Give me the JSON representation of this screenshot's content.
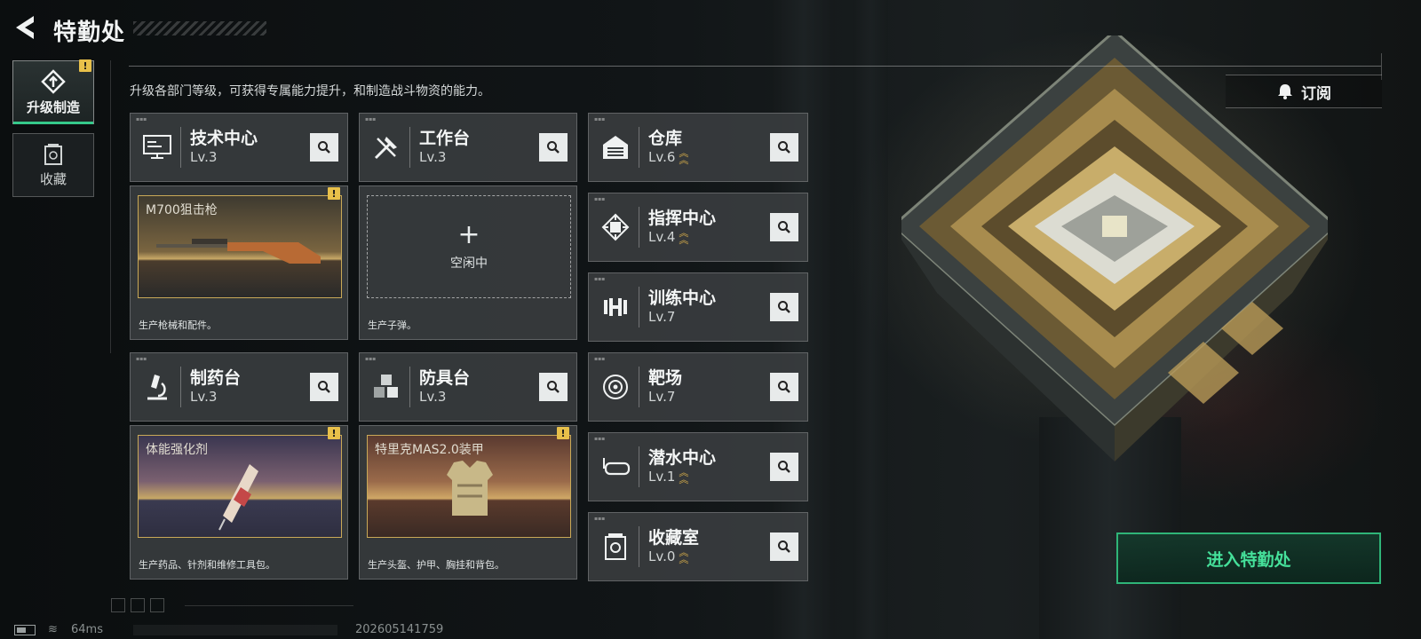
{
  "header": {
    "title": "特勤处",
    "description": "升级各部门等级，可获得专属能力提升，和制造战斗物资的能力。"
  },
  "nav": {
    "items": [
      {
        "label": "升级制造",
        "icon": "upgrade-icon",
        "active": true,
        "alert": "!"
      },
      {
        "label": "收藏",
        "icon": "collection-icon",
        "active": false
      }
    ]
  },
  "subscribe": {
    "label": "订阅",
    "icon": "bell-icon"
  },
  "departments": [
    {
      "name": "技术中心",
      "level": "Lv.3",
      "icon": "monitor-icon",
      "upgradable": false
    },
    {
      "name": "工作台",
      "level": "Lv.3",
      "icon": "tools-icon",
      "upgradable": false
    },
    {
      "name": "仓库",
      "level": "Lv.6",
      "icon": "warehouse-icon",
      "upgradable": true
    },
    {
      "name": "指挥中心",
      "level": "Lv.4",
      "icon": "chip-icon",
      "upgradable": true
    },
    {
      "name": "训练中心",
      "level": "Lv.7",
      "icon": "dumbbell-icon",
      "upgradable": false
    },
    {
      "name": "制药台",
      "level": "Lv.3",
      "icon": "microscope-icon",
      "upgradable": false
    },
    {
      "name": "防具台",
      "level": "Lv.3",
      "icon": "blocks-icon",
      "upgradable": false
    },
    {
      "name": "靶场",
      "level": "Lv.7",
      "icon": "target-icon",
      "upgradable": false
    },
    {
      "name": "潜水中心",
      "level": "Lv.1",
      "icon": "diving-mask-icon",
      "upgradable": true
    },
    {
      "name": "收藏室",
      "level": "Lv.0",
      "icon": "collection-room-icon",
      "upgradable": true
    }
  ],
  "production": {
    "tech": {
      "item": "M700狙击枪",
      "caption": "生产枪械和配件。",
      "alert": "!"
    },
    "workbench": {
      "empty_label": "空闲中",
      "caption": "生产子弹。"
    },
    "pharmacy": {
      "item": "体能强化剂",
      "caption": "生产药品、针剂和维修工具包。",
      "alert": "!"
    },
    "armor": {
      "item": "特里克MAS2.0装甲",
      "caption": "生产头盔、护甲、胸挂和背包。",
      "alert": "!"
    }
  },
  "enter_button": {
    "label": "进入特勤处"
  },
  "status_bar": {
    "ping": "64ms",
    "build": "202605141759"
  },
  "colors": {
    "accent_green": "#35c98a",
    "gold": "#c9a957",
    "alert_yellow": "#e8c04a"
  }
}
